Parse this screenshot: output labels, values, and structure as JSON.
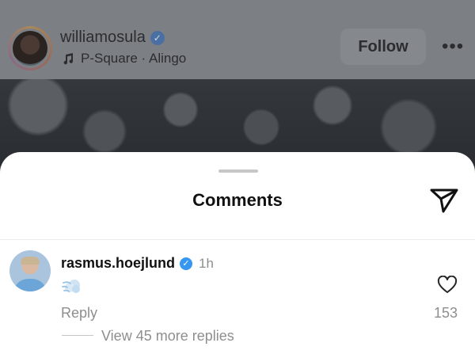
{
  "post": {
    "username": "williamosula",
    "music": "P-Square · Alingo",
    "follow_label": "Follow",
    "more_label": "•••",
    "verified_glyph": "✓"
  },
  "comments_sheet": {
    "title": "Comments",
    "comments": [
      {
        "username": "rasmus.hoejlund",
        "verified_glyph": "✓",
        "time": "1h",
        "content_emoji": "cloud-with-wind-emoji",
        "reply_label": "Reply",
        "likes": "153",
        "view_replies": "View 45 more replies"
      }
    ]
  },
  "colors": {
    "accent_blue": "#3797f0",
    "secondary_text": "#8e8e8e",
    "dim_overlay": "#7c7f83"
  }
}
